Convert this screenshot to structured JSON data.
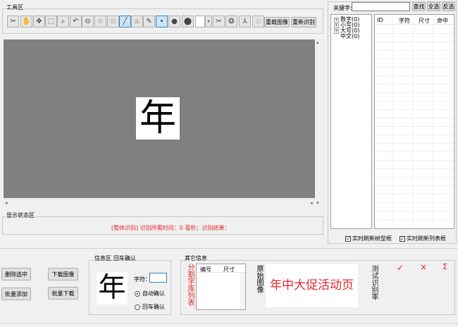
{
  "toolbar": {
    "section_label": "工具区",
    "tools": [
      {
        "icon": "scissors-icon",
        "glyph": "✂"
      },
      {
        "icon": "hand-icon",
        "glyph": "✋"
      },
      {
        "icon": "pan-icon",
        "glyph": "✥"
      },
      {
        "icon": "select-rect-icon",
        "glyph": "⬚"
      },
      {
        "icon": "zoom-icon",
        "glyph": "⌕"
      },
      {
        "icon": "undo-icon",
        "glyph": "↶"
      },
      {
        "icon": "zoom-out-icon",
        "glyph": "⊖"
      },
      {
        "icon": "zoom-in-icon",
        "glyph": "⊕"
      },
      {
        "icon": "fit-icon",
        "glyph": "⊞"
      },
      {
        "icon": "pen-icon",
        "glyph": "╱"
      },
      {
        "icon": "fill-icon",
        "glyph": "♨"
      },
      {
        "icon": "eyedropper-icon",
        "glyph": "✎"
      },
      {
        "icon": "dot-small-icon",
        "glyph": "•"
      },
      {
        "icon": "dot-medium-icon",
        "glyph": "●"
      },
      {
        "icon": "dot-large-icon",
        "glyph": "⬤"
      },
      {
        "icon": "cut-icon",
        "glyph": "✂"
      },
      {
        "icon": "target-icon",
        "glyph": "❂"
      },
      {
        "icon": "rotate-icon",
        "glyph": "⅄"
      },
      {
        "icon": "reset-icon",
        "glyph": "◎"
      }
    ],
    "reload_image_label": "重载图像",
    "re_recognize_label": "重新识别"
  },
  "canvas": {
    "glyph": "年"
  },
  "status": {
    "section_label": "显示状态区",
    "message": "[整体识别] 识别所需时间：0 毫秒；识别结果："
  },
  "search": {
    "label": "关键字:",
    "value": "",
    "find_label": "查找",
    "select_all_label": "全选",
    "invert_label": "反选"
  },
  "tree": {
    "items": [
      "数字(0)",
      "小写(0)",
      "大写(0)",
      "中文(0)"
    ]
  },
  "table": {
    "columns": [
      "ID",
      "字符",
      "尺寸",
      "命中"
    ]
  },
  "options": {
    "refresh_tree_label": "实时刷新树型框",
    "refresh_list_label": "实时刷新列表框"
  },
  "actions": {
    "delete_selected": "删除选中",
    "batch_add": "批量添加",
    "download_image": "下载图像",
    "batch_download": "批量下载"
  },
  "info": {
    "section_label": "信息区",
    "enter_confirm_label": "回车确认",
    "glyph": "年",
    "char_label": "字符：",
    "char_value": "",
    "auto_confirm_label": "自动确认",
    "enter_confirm_radio_label": "回车确认"
  },
  "other": {
    "section_label": "其它信息",
    "split_list_label": "分割字库列表",
    "columns": [
      "编号",
      "尺寸"
    ],
    "original_image_label": "原始图像",
    "sample_text": "年中大促活动页",
    "test_rate_label": "测试识别率",
    "check_glyph": "✓",
    "cross_glyph": "×",
    "sigma_glyph": "Σ"
  },
  "colors": {
    "accent_red": "#e5262c",
    "canvas_gray": "#808080"
  }
}
